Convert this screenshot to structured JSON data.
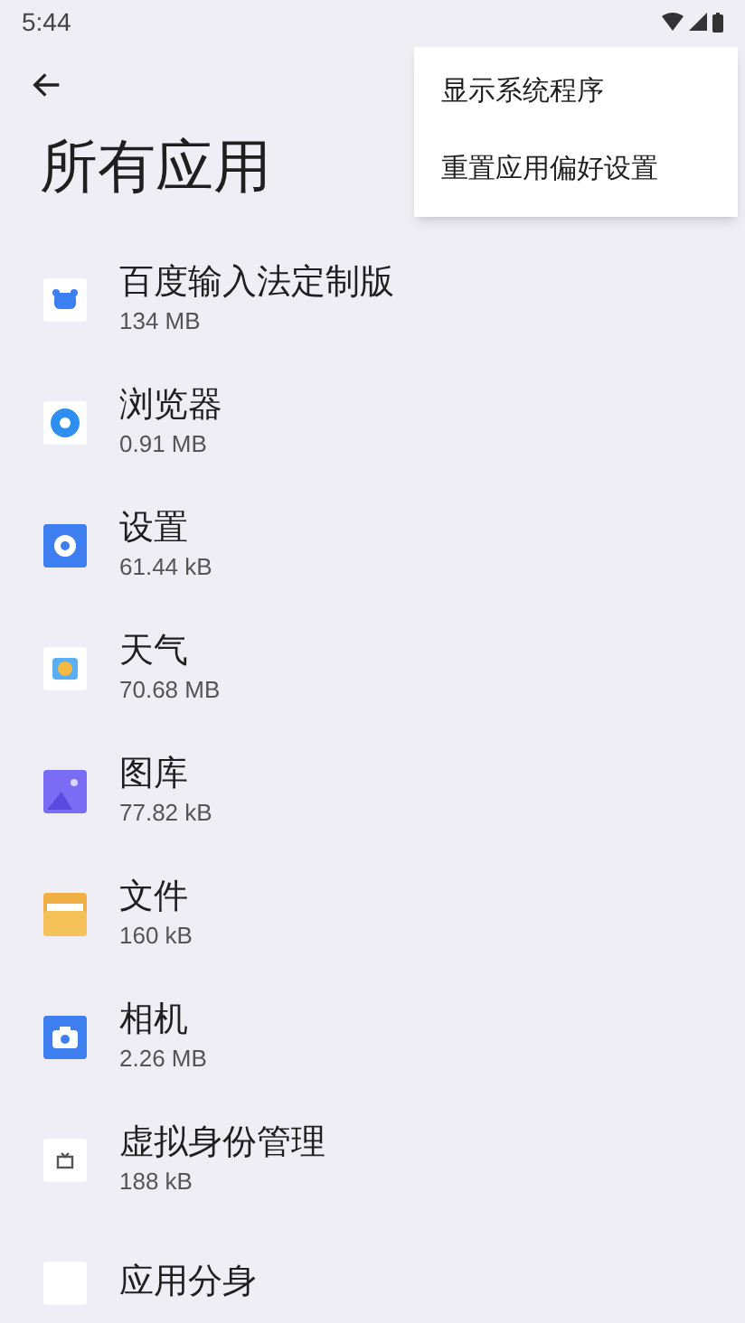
{
  "status_bar": {
    "time": "5:44"
  },
  "title": "所有应用",
  "menu": [
    "显示系统程序",
    "重置应用偏好设置"
  ],
  "apps": [
    {
      "kind": "keyboard",
      "name": "百度输入法定制版",
      "size": "134 MB"
    },
    {
      "kind": "browser",
      "name": "浏览器",
      "size": "0.91 MB"
    },
    {
      "kind": "settings",
      "name": "设置",
      "size": "61.44 kB"
    },
    {
      "kind": "weather",
      "name": "天气",
      "size": "70.68 MB"
    },
    {
      "kind": "gallery",
      "name": "图库",
      "size": "77.82 kB"
    },
    {
      "kind": "files",
      "name": "文件",
      "size": "160 kB"
    },
    {
      "kind": "camera",
      "name": "相机",
      "size": "2.26 MB"
    },
    {
      "kind": "tv",
      "name": "虚拟身份管理",
      "size": "188 kB"
    },
    {
      "kind": "blank",
      "name": "应用分身"
    }
  ]
}
